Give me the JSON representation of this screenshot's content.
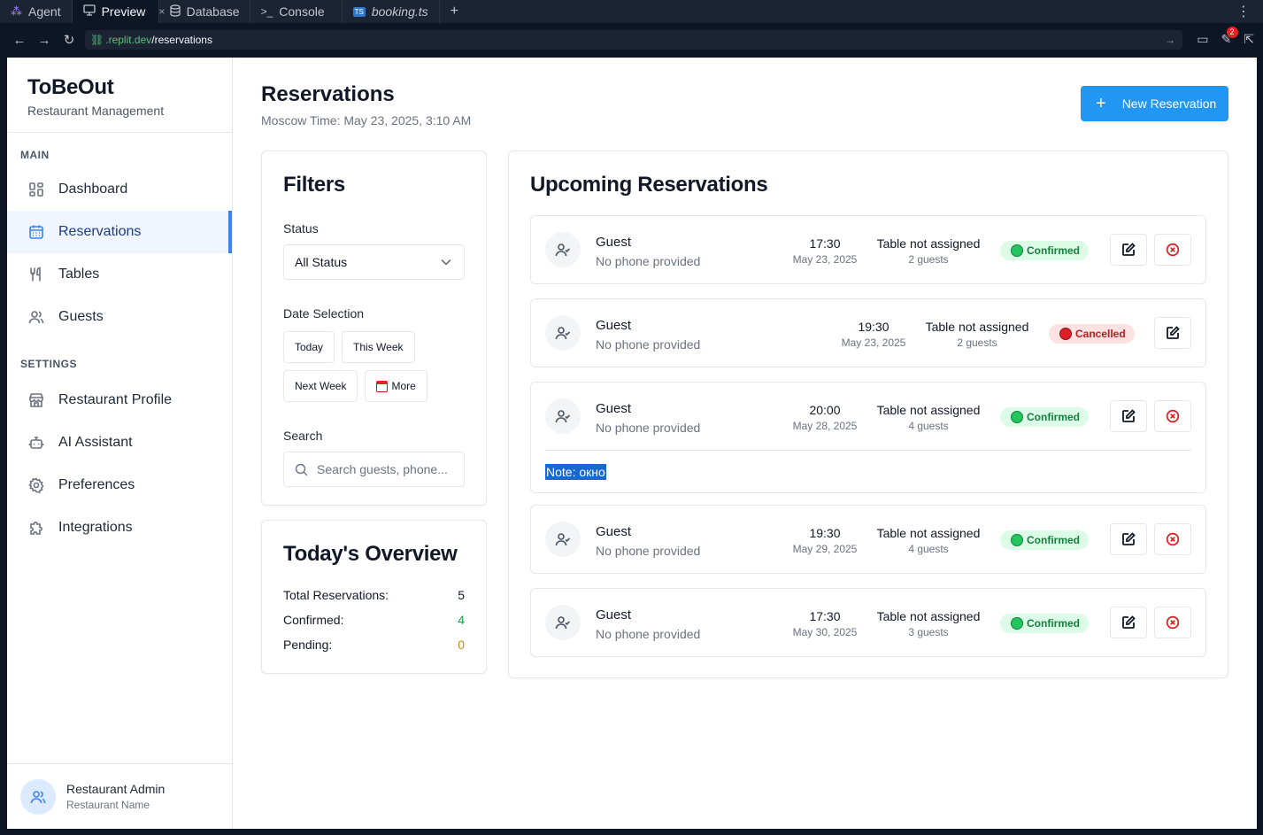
{
  "ide": {
    "tabs": [
      {
        "label": "Agent",
        "icon": "agent-icon"
      },
      {
        "label": "Preview",
        "icon": "monitor-icon",
        "close": "×"
      },
      {
        "label": "Database",
        "icon": "database-icon"
      },
      {
        "label": "Console",
        "icon": "terminal-icon"
      },
      {
        "label": "booking.ts",
        "icon": "typescript-icon"
      }
    ],
    "url_host": ".replit.dev",
    "url_path": "/reservations",
    "notification_count": "2"
  },
  "sidebar": {
    "brand_title": "ToBeOut",
    "brand_subtitle": "Restaurant Management",
    "main_label": "MAIN",
    "settings_label": "SETTINGS",
    "main_items": [
      {
        "label": "Dashboard",
        "icon": "dashboard-icon"
      },
      {
        "label": "Reservations",
        "icon": "calendar-icon",
        "active": true
      },
      {
        "label": "Tables",
        "icon": "utensils-icon"
      },
      {
        "label": "Guests",
        "icon": "users-icon"
      }
    ],
    "settings_items": [
      {
        "label": "Restaurant Profile",
        "icon": "store-icon"
      },
      {
        "label": "AI Assistant",
        "icon": "bot-icon"
      },
      {
        "label": "Preferences",
        "icon": "gear-icon"
      },
      {
        "label": "Integrations",
        "icon": "puzzle-icon"
      }
    ],
    "user_name": "Restaurant Admin",
    "user_sub": "Restaurant Name"
  },
  "header": {
    "title": "Reservations",
    "time": "Moscow Time: May 23, 2025, 3:10 AM",
    "new_button": "New Reservation"
  },
  "filters": {
    "title": "Filters",
    "status_label": "Status",
    "status_value": "All Status",
    "date_label": "Date Selection",
    "date_buttons": [
      "Today",
      "This Week",
      "Next Week",
      "More"
    ],
    "search_label": "Search",
    "search_placeholder": "Search guests, phone..."
  },
  "overview": {
    "title": "Today's Overview",
    "rows": [
      {
        "label": "Total Reservations:",
        "value": "5",
        "color": "#111827"
      },
      {
        "label": "Confirmed:",
        "value": "4",
        "color": "#16a34a"
      },
      {
        "label": "Pending:",
        "value": "0",
        "color": "#ca8a04"
      }
    ]
  },
  "upcoming": {
    "title": "Upcoming Reservations",
    "items": [
      {
        "name": "Guest",
        "phone": "No phone provided",
        "time": "17:30",
        "date": "May 23, 2025",
        "table": "Table not assigned",
        "guests": "2 guests",
        "status": "Confirmed",
        "note": ""
      },
      {
        "name": "Guest",
        "phone": "No phone provided",
        "time": "19:30",
        "date": "May 23, 2025",
        "table": "Table not assigned",
        "guests": "2 guests",
        "status": "Cancelled",
        "note": ""
      },
      {
        "name": "Guest",
        "phone": "No phone provided",
        "time": "20:00",
        "date": "May 28, 2025",
        "table": "Table not assigned",
        "guests": "4 guests",
        "status": "Confirmed",
        "note": "Note: окно"
      },
      {
        "name": "Guest",
        "phone": "No phone provided",
        "time": "19:30",
        "date": "May 29, 2025",
        "table": "Table not assigned",
        "guests": "4 guests",
        "status": "Confirmed",
        "note": ""
      },
      {
        "name": "Guest",
        "phone": "No phone provided",
        "time": "17:30",
        "date": "May 30, 2025",
        "table": "Table not assigned",
        "guests": "3 guests",
        "status": "Confirmed",
        "note": ""
      }
    ]
  }
}
